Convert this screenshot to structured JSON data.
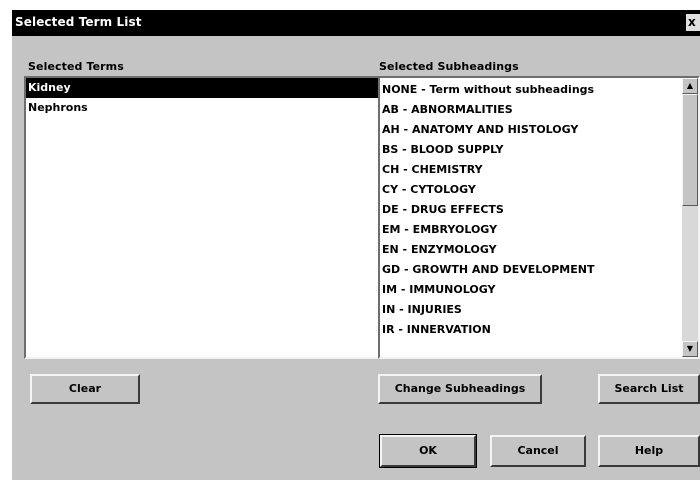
{
  "window": {
    "title": "Selected Term List",
    "close_glyph": "x"
  },
  "terms": {
    "label": "Selected Terms",
    "items": [
      {
        "label": "Kidney",
        "selected": true
      },
      {
        "label": "Nephrons",
        "selected": false
      }
    ]
  },
  "subheadings": {
    "label": "Selected Subheadings",
    "items": [
      "NONE - Term without subheadings",
      "AB - ABNORMALITIES",
      "AH - ANATOMY AND HISTOLOGY",
      "BS - BLOOD SUPPLY",
      "CH - CHEMISTRY",
      "CY - CYTOLOGY",
      "DE - DRUG EFFECTS",
      "EM - EMBRYOLOGY",
      "EN - ENZYMOLOGY",
      "GD - GROWTH AND DEVELOPMENT",
      "IM - IMMUNOLOGY",
      "IN - INJURIES",
      "IR - INNERVATION"
    ],
    "scroll_up_glyph": "▲",
    "scroll_down_glyph": "▼"
  },
  "buttons": {
    "clear": "Clear",
    "change_subheadings": "Change Subheadings",
    "search_list": "Search List",
    "ok": "OK",
    "cancel": "Cancel",
    "help": "Help"
  },
  "icons": {
    "close": "close-icon",
    "scroll_up": "arrow-up-icon",
    "scroll_down": "arrow-down-icon"
  }
}
